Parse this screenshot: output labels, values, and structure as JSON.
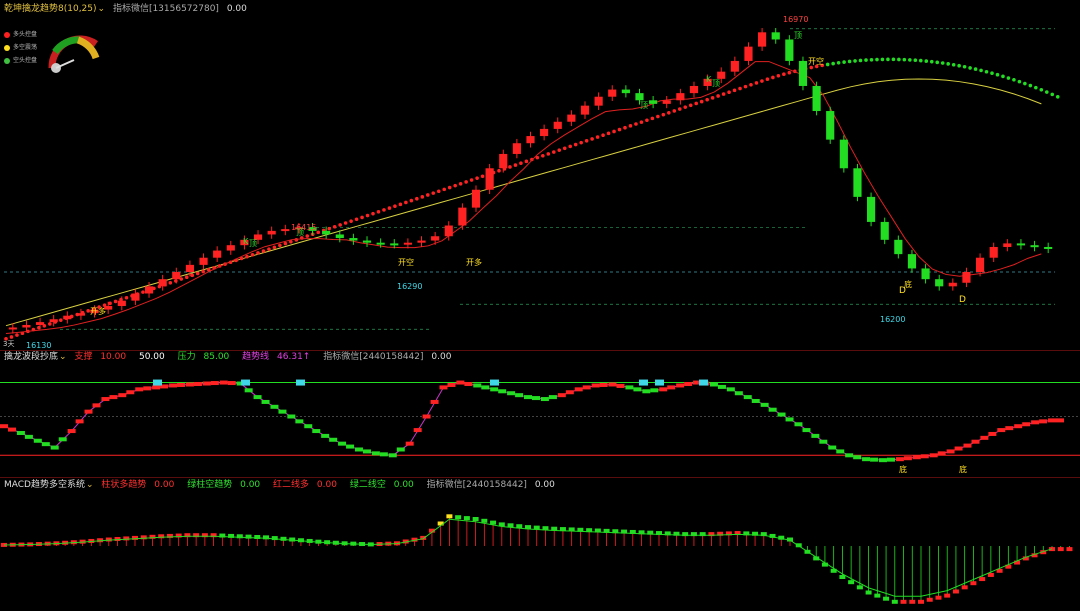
{
  "colors": {
    "up": "#ff2222",
    "down": "#22dd22",
    "ma_red": "#e02020",
    "ma_green": "#20c020",
    "ma_yellow": "#d8d040",
    "pink": "#cc33cc",
    "cyan": "#40d8e8",
    "yellow": "#ffe020",
    "orange": "#ff9020"
  },
  "panel1": {
    "title": "乾坤擒龙趋势8(10,25)",
    "wechat": "指标微信[13156572780]",
    "value": "0.00",
    "legend": [
      {
        "label": "多头控盘",
        "color": "#ff2020"
      },
      {
        "label": "多空震荡",
        "color": "#ffe020"
      },
      {
        "label": "空头控盘",
        "color": "#20c020"
      }
    ]
  },
  "panel2": {
    "title": "擒龙波段抄底",
    "items": [
      {
        "label": "支撑",
        "value": "10.00",
        "color": "#ff3030"
      },
      {
        "label": "",
        "value": "50.00",
        "color": "#ffffff"
      },
      {
        "label": "压力",
        "value": "85.00",
        "color": "#30e030"
      },
      {
        "label": "趋势线",
        "value": "46.31↑",
        "color": "#e040e0"
      }
    ],
    "wechat": "指标微信[2440158442]",
    "value": "0.00"
  },
  "panel3": {
    "title": "MACD趋势多空系统",
    "items": [
      {
        "label": "柱状多趋势",
        "value": "0.00",
        "color": "#ff3030"
      },
      {
        "label": "绿柱空趋势",
        "value": "0.00",
        "color": "#30e030"
      },
      {
        "label": "红二线多",
        "value": "0.00",
        "color": "#ff3030"
      },
      {
        "label": "绿二线空",
        "value": "0.00",
        "color": "#30e030"
      }
    ],
    "wechat": "指标微信[2440158442]",
    "value": "0.00"
  },
  "annotations": {
    "price_16970": "16970",
    "price_16415": "16415",
    "price_16290": "16290",
    "price_16200": "16200",
    "price_16130": "16130",
    "kai_duo": "开多",
    "kai_kong": "开空",
    "ding": "顶",
    "di": "底",
    "K": "K",
    "D": "D",
    "days": "3天"
  },
  "chart_data": [
    {
      "type": "candlestick",
      "title": "乾坤擒龙趋势8(10,25)",
      "close": [
        16135,
        16142,
        16150,
        16158,
        16168,
        16175,
        16185,
        16195,
        16210,
        16230,
        16250,
        16270,
        16290,
        16310,
        16330,
        16350,
        16365,
        16380,
        16395,
        16405,
        16410,
        16415,
        16405,
        16395,
        16385,
        16378,
        16372,
        16370,
        16368,
        16372,
        16378,
        16390,
        16420,
        16470,
        16520,
        16580,
        16620,
        16650,
        16670,
        16690,
        16710,
        16730,
        16755,
        16780,
        16800,
        16790,
        16770,
        16760,
        16770,
        16790,
        16810,
        16830,
        16850,
        16880,
        16920,
        16960,
        16940,
        16880,
        16810,
        16740,
        16660,
        16580,
        16500,
        16430,
        16380,
        16340,
        16300,
        16270,
        16250,
        16260,
        16290,
        16330,
        16360,
        16370,
        16365,
        16360,
        16355
      ],
      "annotations": [
        {
          "label": "16970",
          "type": "high"
        },
        {
          "label": "16415",
          "type": "high"
        },
        {
          "label": "16290",
          "type": "low"
        },
        {
          "label": "16200",
          "type": "low"
        },
        {
          "label": "16130",
          "type": "low"
        },
        {
          "label": "开多"
        },
        {
          "label": "开空"
        }
      ]
    },
    {
      "type": "line",
      "title": "擒龙波段抄底",
      "levels": {
        "support": 10,
        "mid": 50,
        "pressure": 85
      },
      "values": [
        40,
        33,
        25,
        18,
        35,
        55,
        68,
        72,
        78,
        80,
        82,
        83,
        84,
        85,
        84,
        70,
        60,
        50,
        40,
        30,
        22,
        16,
        12,
        10,
        22,
        50,
        80,
        85,
        82,
        78,
        74,
        70,
        68,
        72,
        78,
        82,
        83,
        80,
        76,
        78,
        82,
        85,
        83,
        78,
        70,
        62,
        52,
        42,
        30,
        18,
        10,
        6,
        5,
        6,
        8,
        10,
        14,
        20,
        28,
        36,
        40,
        44,
        46
      ],
      "annotations": [
        {
          "label": "顶"
        },
        {
          "label": "底"
        }
      ]
    },
    {
      "type": "bar",
      "title": "MACD趋势多空系统",
      "values": [
        0.02,
        0.03,
        0.05,
        0.08,
        0.12,
        0.15,
        0.18,
        0.2,
        0.2,
        0.18,
        0.16,
        0.12,
        0.08,
        0.05,
        0.03,
        0.05,
        0.15,
        0.55,
        0.5,
        0.4,
        0.35,
        0.32,
        0.3,
        0.28,
        0.26,
        0.24,
        0.22,
        0.22,
        0.24,
        0.22,
        0.12,
        -0.2,
        -0.5,
        -0.75,
        -0.9,
        -0.9,
        -0.8,
        -0.6,
        -0.4,
        -0.2,
        -0.05
      ],
      "ylim": [
        -1,
        1
      ]
    }
  ]
}
